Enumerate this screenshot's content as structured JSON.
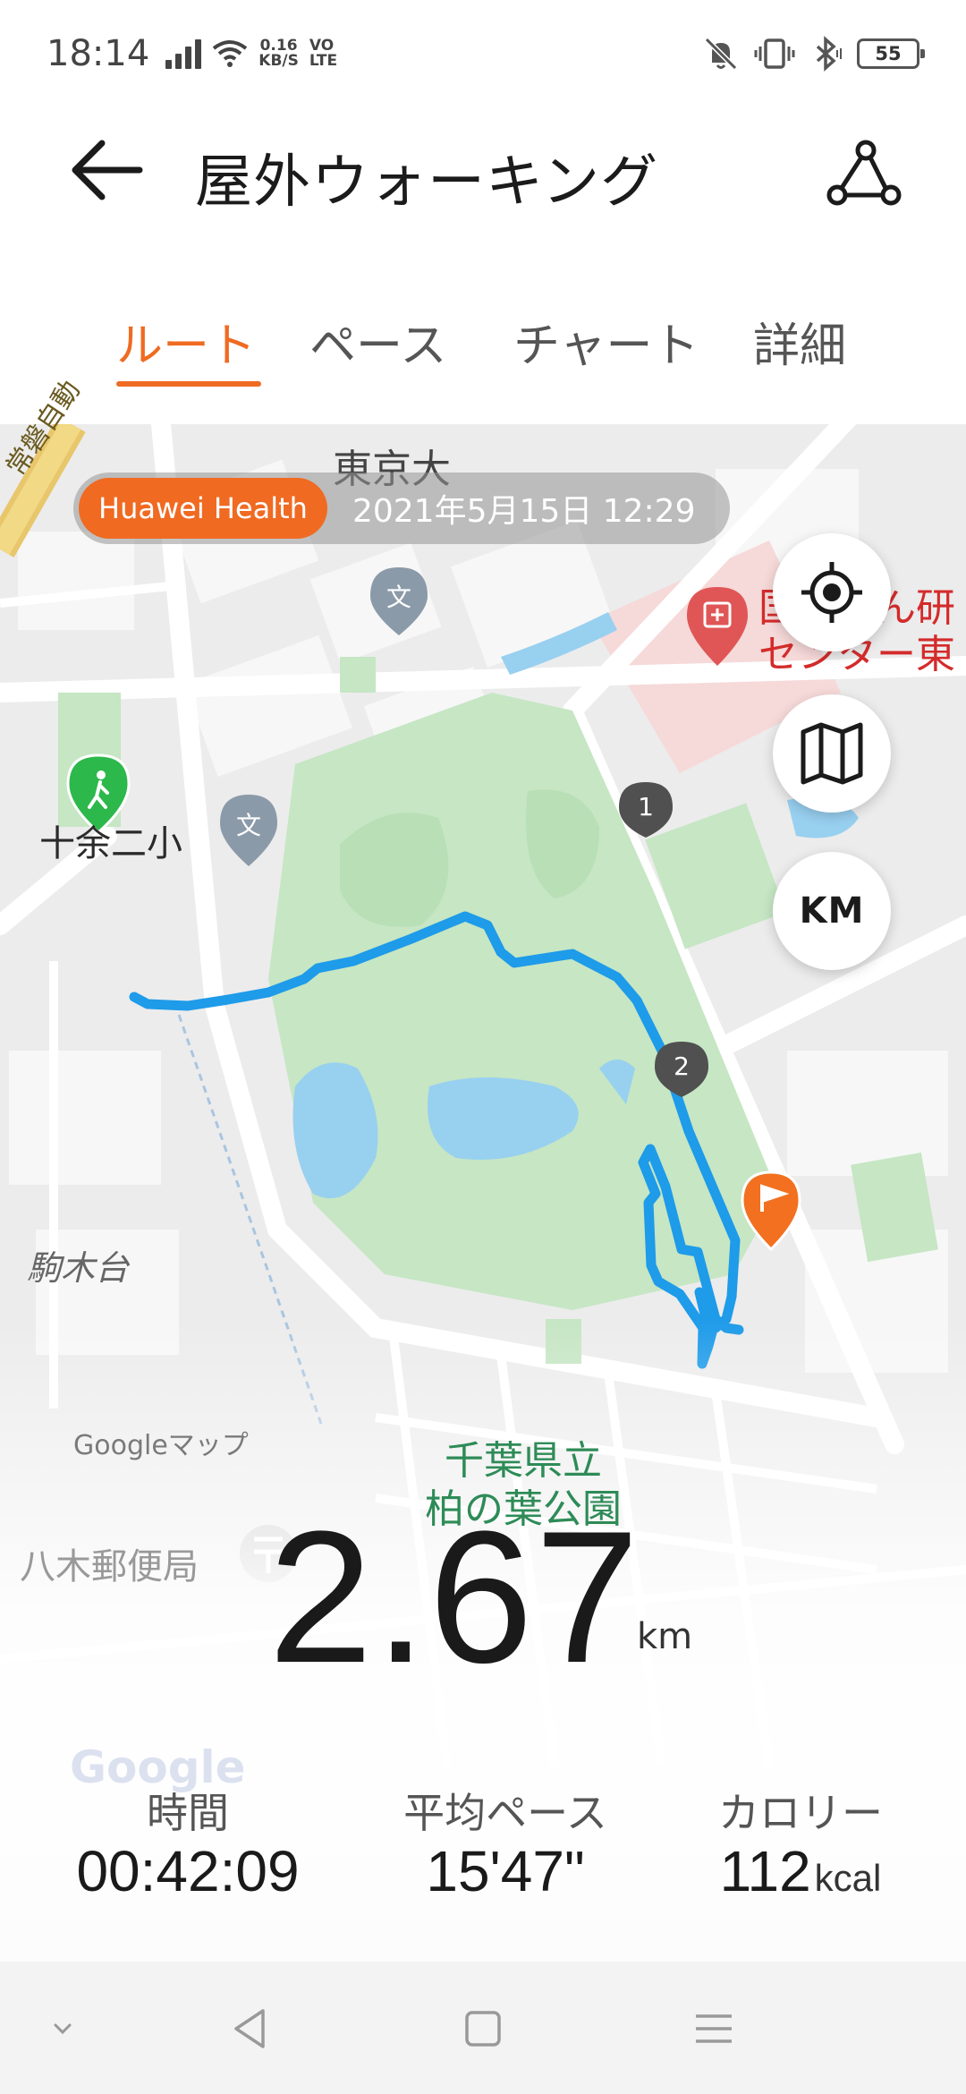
{
  "status_bar": {
    "time": "18:14",
    "net_speed_value": "0.16",
    "net_speed_unit": "KB/S",
    "volte_top": "VO",
    "volte_bottom": "LTE",
    "battery": "55"
  },
  "header": {
    "title": "屋外ウォーキング",
    "back_icon": "arrow-left-icon",
    "share_icon": "route-share-icon"
  },
  "tabs": [
    {
      "label": "ルート",
      "active": true
    },
    {
      "label": "ペース",
      "active": false
    },
    {
      "label": "チャート",
      "active": false
    },
    {
      "label": "詳細",
      "active": false
    }
  ],
  "map": {
    "watermark_brand": "Huawei Health",
    "watermark_datetime": "2021年5月15日 12:29",
    "labels": {
      "university": "東京大",
      "school": "十余二小",
      "park_line1": "千葉県立",
      "park_line2": "柏の葉公園",
      "area": "駒木台",
      "post_office": "八木郵便局",
      "expressway": "常磐自動",
      "hospital_line1": "国立がん研",
      "hospital_line2": "センター東"
    },
    "markers": {
      "start": "walker-icon",
      "lap1": "1",
      "lap2": "2",
      "finish": "flag-icon"
    },
    "attribution": "Googleマップ",
    "google_logo": "Google",
    "controls": {
      "locate_icon": "locate-icon",
      "map_type_icon": "map-icon",
      "unit_label": "KM"
    },
    "colors": {
      "route": "#1e9be9",
      "park": "#c6e6c4",
      "water": "#98d0f0",
      "accent": "#ef6b22"
    }
  },
  "summary": {
    "distance_value": "2.67",
    "distance_unit": "km",
    "stats": [
      {
        "label": "時間",
        "value": "00:42:09",
        "unit": ""
      },
      {
        "label": "平均ペース",
        "value": "15'47\"",
        "unit": ""
      },
      {
        "label": "カロリー",
        "value": "112",
        "unit": "kcal"
      }
    ]
  },
  "nav_bar": {
    "icons": [
      "chevron-down-icon",
      "back-triangle-icon",
      "home-square-icon",
      "menu-icon"
    ]
  }
}
